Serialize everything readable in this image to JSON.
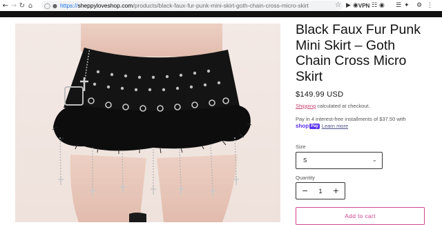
{
  "browser": {
    "url_scheme": "https://",
    "url_host": "sheppyloveshop.com",
    "url_path": "/products/black-faux-fur-punk-mini-skirt-goth-chain-cross-micro-skirt",
    "vpn_label": "VPN"
  },
  "product": {
    "title": "Black Faux Fur Punk Mini Skirt – Goth Chain Cross Micro Skirt",
    "price": "$149.99 USD",
    "shipping_link": "Shipping",
    "shipping_rest": " calculated at checkout.",
    "installments_text": "Pay in 4 interest-free installments of $37.50 with",
    "shop_logo_text": "shop",
    "shop_logo_pay": "Pay",
    "learn_more": "Learn more",
    "size_label": "Size",
    "size_value": "S",
    "quantity_label": "Quantity",
    "quantity_value": "1",
    "add_to_cart": "Add to cart"
  },
  "icons": {
    "back": "arrow-left-icon",
    "forward": "arrow-right-icon",
    "reload": "reload-icon",
    "home": "home-icon",
    "bookmark": "star-icon"
  }
}
